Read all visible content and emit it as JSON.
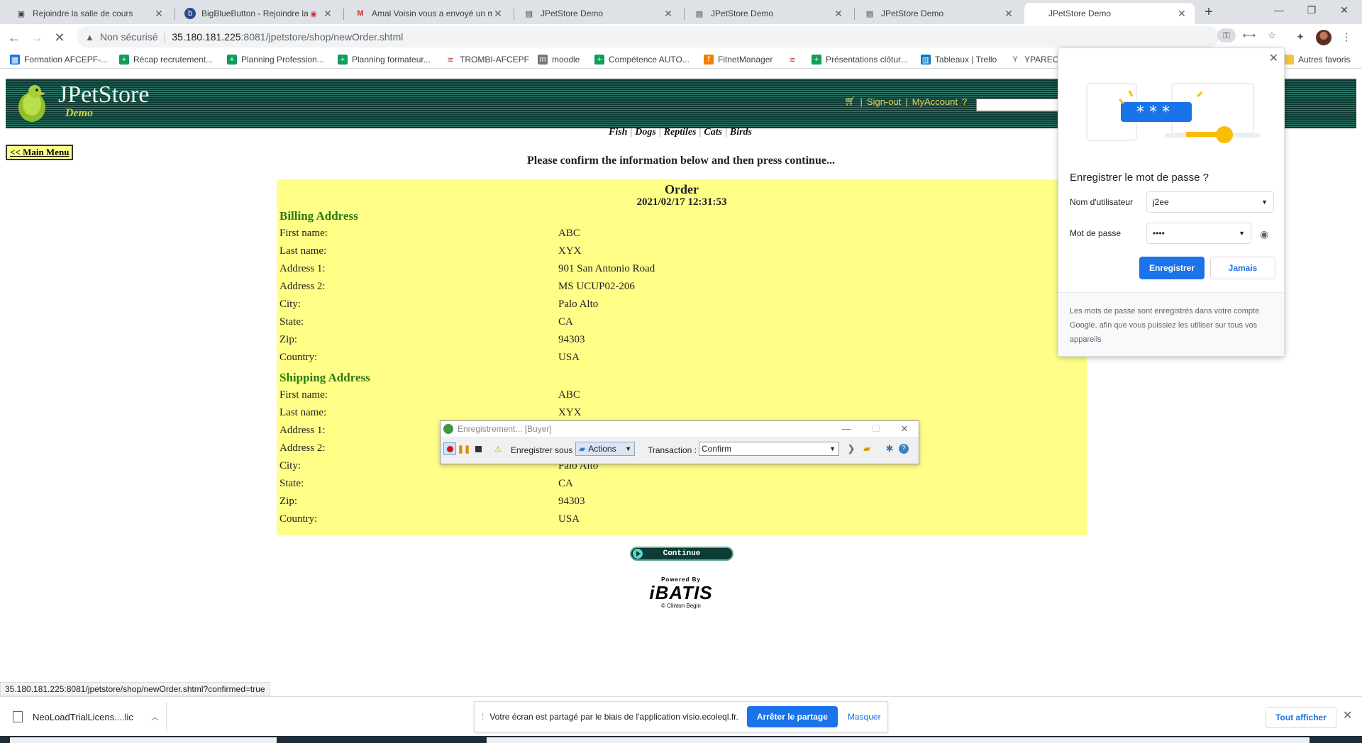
{
  "tabs": [
    {
      "title": "Rejoindre la salle de cours",
      "icon": "meeting-icon"
    },
    {
      "title": "BigBlueButton - Rejoindre la",
      "icon": "bigbluebutton-icon"
    },
    {
      "title": "Amal Voisin vous a envoyé un me",
      "icon": "gmail-icon"
    },
    {
      "title": "JPetStore Demo",
      "icon": "document-icon"
    },
    {
      "title": "JPetStore Demo",
      "icon": "document-icon"
    },
    {
      "title": "JPetStore Demo",
      "icon": "document-icon"
    },
    {
      "title": "JPetStore Demo",
      "icon": "document-icon",
      "active": true
    }
  ],
  "address_bar": {
    "security": "Non sécurisé",
    "host": "35.180.181.225",
    "path": ":8081/jpetstore/shop/newOrder.shtml"
  },
  "bookmarks": [
    {
      "label": "Formation AFCEPF-...",
      "icon": "calendar-icon",
      "color": "#1a73e8"
    },
    {
      "label": "Récap recrutement...",
      "icon": "sheets-icon",
      "color": "#0f9d58"
    },
    {
      "label": "Planning Profession...",
      "icon": "sheets-icon",
      "color": "#0f9d58"
    },
    {
      "label": "Planning formateur...",
      "icon": "sheets-icon",
      "color": "#0f9d58"
    },
    {
      "label": "TROMBI-AFCEPF",
      "icon": "trombi-icon",
      "color": "#c0392b"
    },
    {
      "label": "moodle",
      "icon": "moodle-icon",
      "color": "#777777"
    },
    {
      "label": "Compétence AUTO...",
      "icon": "sheets-icon",
      "color": "#0f9d58"
    },
    {
      "label": "FitnetManager",
      "icon": "fitnet-icon",
      "color": "#f57c00"
    },
    {
      "label": "Présentations clôtur...",
      "icon": "sheets-icon",
      "color": "#0f9d58"
    },
    {
      "label": "Tableaux | Trello",
      "icon": "trello-icon",
      "color": "#0079bf"
    },
    {
      "label": "YPAREO",
      "icon": "ypareo-icon",
      "color": "#555555"
    }
  ],
  "bookmarks_other": "Autres favoris",
  "store": {
    "brand": "JPetStore",
    "brand_sub": "Demo",
    "sign_out": "Sign-out",
    "my_account": "MyAccount",
    "help": "?",
    "categories": [
      "Fish",
      "Dogs",
      "Reptiles",
      "Cats",
      "Birds"
    ],
    "main_menu": "<< Main Menu",
    "confirm_message": "Please confirm the information below and then press continue...",
    "continue_label": "Continue",
    "powered_by": "Powered By",
    "ibatis": "iBATIS",
    "credit": "© Clinton Begin"
  },
  "order": {
    "title": "Order",
    "date": "2021/02/17 12:31:53",
    "billing_heading": "Billing Address",
    "shipping_heading": "Shipping Address",
    "billing": [
      {
        "label": "First name:",
        "value": "ABC"
      },
      {
        "label": "Last name:",
        "value": "XYX"
      },
      {
        "label": "Address 1:",
        "value": "901 San Antonio Road"
      },
      {
        "label": "Address 2:",
        "value": "MS UCUP02-206"
      },
      {
        "label": "City:",
        "value": "Palo Alto"
      },
      {
        "label": "State:",
        "value": "CA"
      },
      {
        "label": "Zip:",
        "value": "94303"
      },
      {
        "label": "Country:",
        "value": "USA"
      }
    ],
    "shipping": [
      {
        "label": "First name:",
        "value": "ABC"
      },
      {
        "label": "Last name:",
        "value": "XYX"
      },
      {
        "label": "Address 1:",
        "value": ""
      },
      {
        "label": "Address 2:",
        "value": ""
      },
      {
        "label": "City:",
        "value": "Palo Alto"
      },
      {
        "label": "State:",
        "value": "CA"
      },
      {
        "label": "Zip:",
        "value": "94303"
      },
      {
        "label": "Country:",
        "value": "USA"
      }
    ]
  },
  "recorder": {
    "title": "Enregistrement... [Buyer]",
    "save_label": "Enregistrer sous :",
    "container": "Actions",
    "transaction_label": "Transaction :",
    "transaction_value": "Confirm"
  },
  "password_bubble": {
    "title": "Enregistrer le mot de passe ?",
    "username_label": "Nom d'utilisateur",
    "username_value": "j2ee",
    "password_label": "Mot de passe",
    "password_value": "••••",
    "save": "Enregistrer",
    "never": "Jamais",
    "footer": "Les mots de passe sont enregistrés dans votre compte Google, afin que vous puissiez les utiliser sur tous vos appareils"
  },
  "status_url": "35.180.181.225:8081/jpetstore/shop/newOrder.shtml?confirmed=true",
  "download": {
    "file": "NeoLoadTrialLicens....lic"
  },
  "share_bar": {
    "message": "Votre écran est partagé par le biais de l'application visio.ecoleql.fr.",
    "stop": "Arrêter le partage",
    "hide": "Masquer"
  },
  "show_all": "Tout afficher",
  "colors": {
    "accent": "#1a73e8",
    "page_table": "#ffff88",
    "section": "#2b7a14",
    "header": "#0d3a33"
  }
}
